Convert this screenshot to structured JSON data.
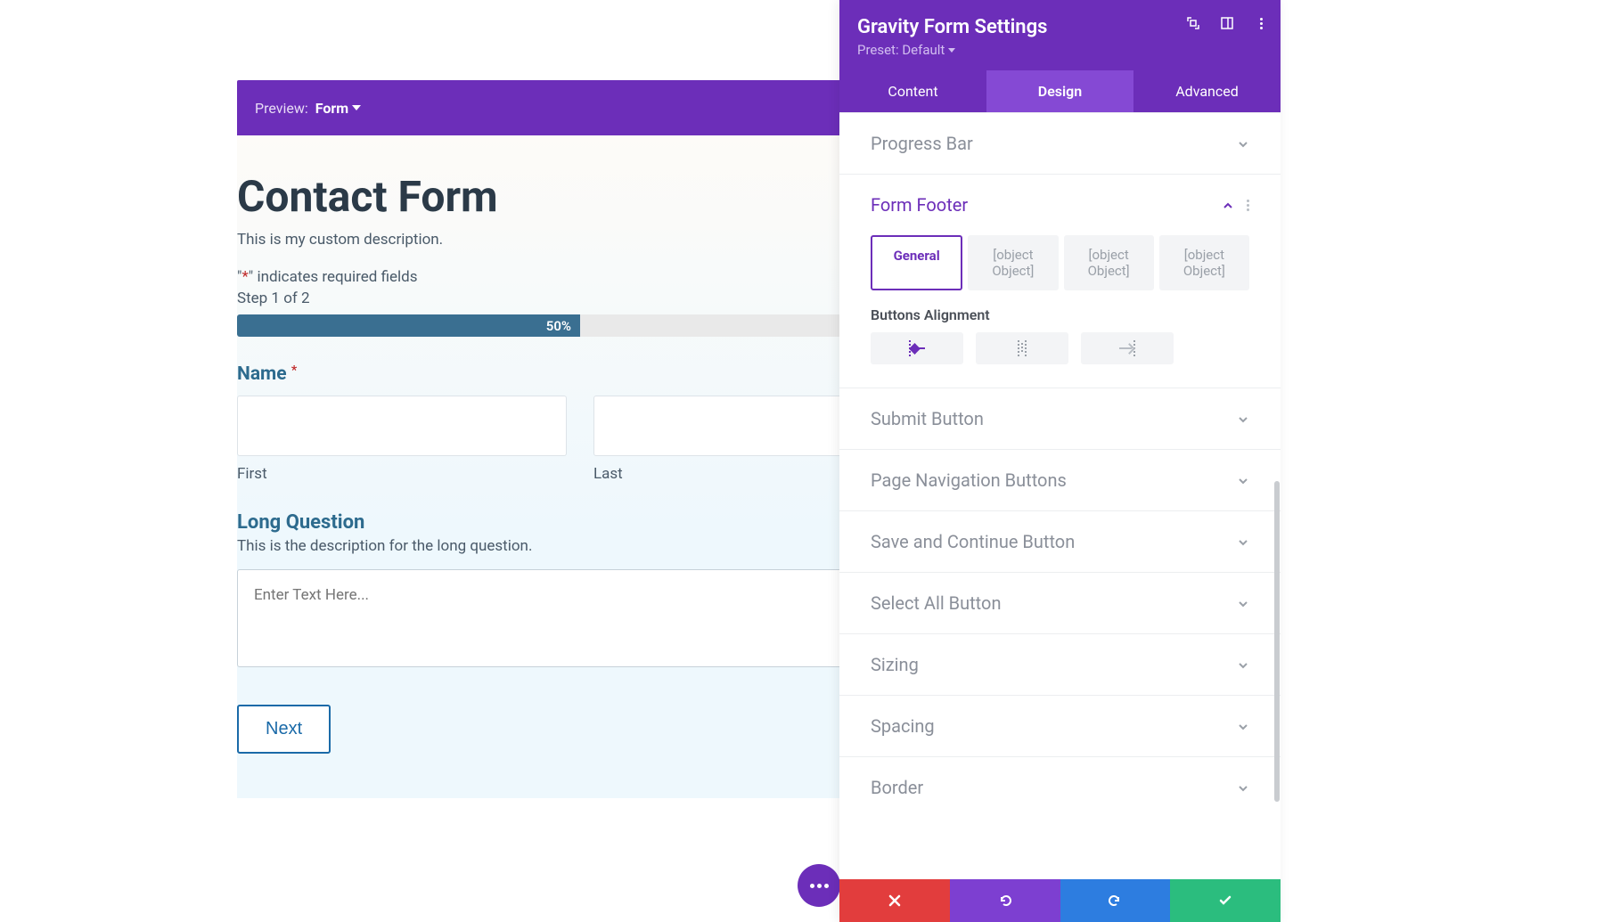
{
  "preview": {
    "label": "Preview:",
    "dropdown": "Form"
  },
  "form": {
    "title": "Contact Form",
    "description": "This is my custom description.",
    "required_note_prefix": "\"",
    "required_note_star": "*",
    "required_note_suffix": "\" indicates required fields",
    "step_note": "Step 1 of 2",
    "progress_pct": "50%",
    "name": {
      "label": "Name",
      "first_sub": "First",
      "last_sub": "Last"
    },
    "long_question": {
      "label": "Long Question",
      "description": "This is the description for the long question.",
      "placeholder": "Enter Text Here..."
    },
    "next_label": "Next"
  },
  "panel": {
    "title": "Gravity Form Settings",
    "preset": "Preset: Default",
    "tabs": {
      "content": "Content",
      "design": "Design",
      "advanced": "Advanced"
    },
    "sections": {
      "progress_bar": "Progress Bar",
      "form_footer": "Form Footer",
      "submit_button": "Submit Button",
      "page_nav": "Page Navigation Buttons",
      "save_continue": "Save and Continue Button",
      "select_all": "Select All Button",
      "sizing": "Sizing",
      "spacing": "Spacing",
      "border": "Border"
    },
    "form_footer": {
      "subtabs": {
        "general": "General",
        "t1": "[object Object]",
        "t2": "[object Object]",
        "t3": "[object Object]"
      },
      "alignment_label": "Buttons Alignment"
    }
  }
}
